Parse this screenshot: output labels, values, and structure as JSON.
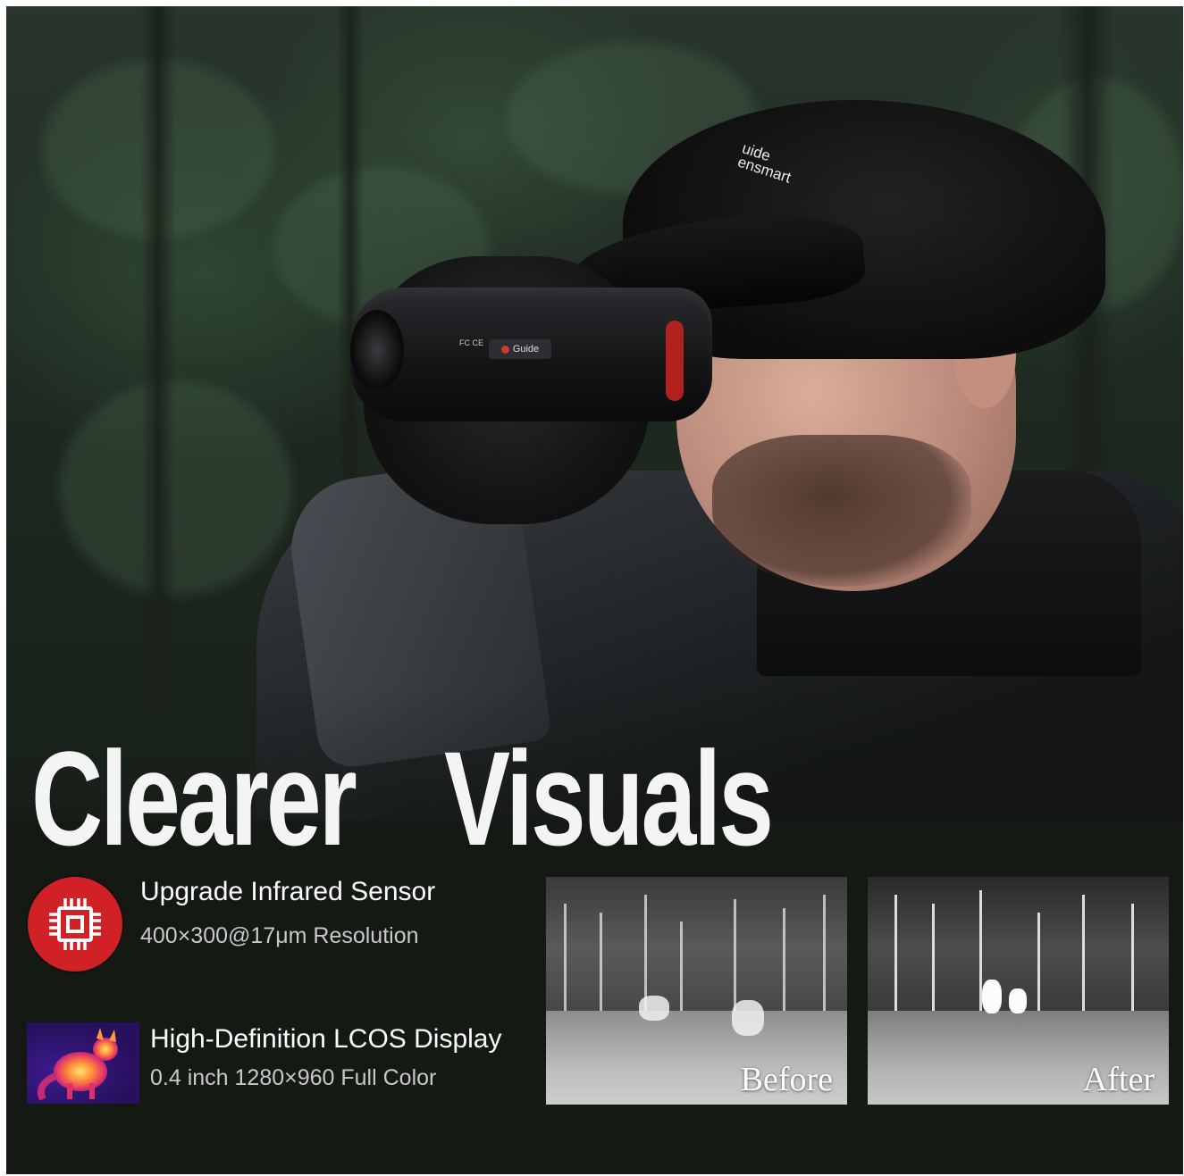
{
  "headline": "Clearer  Visuals",
  "cap_logo": "uide\nensmart",
  "device": {
    "brand": "Guide",
    "cert": "FC CE"
  },
  "features": [
    {
      "icon": "chip-icon",
      "title": "Upgrade Infrared Sensor",
      "subtitle": "400×300@17μm Resolution"
    },
    {
      "icon": "thermal-fox-thumbnail",
      "title": "High-Definition LCOS Display",
      "subtitle": "0.4 inch 1280×960 Full Color"
    }
  ],
  "comparison": {
    "before_label": "Before",
    "after_label": "After"
  },
  "colors": {
    "accent_red": "#cf2126",
    "panel_bg": "#141914",
    "text_white": "#ffffff",
    "text_gray": "#c8c8c8"
  }
}
